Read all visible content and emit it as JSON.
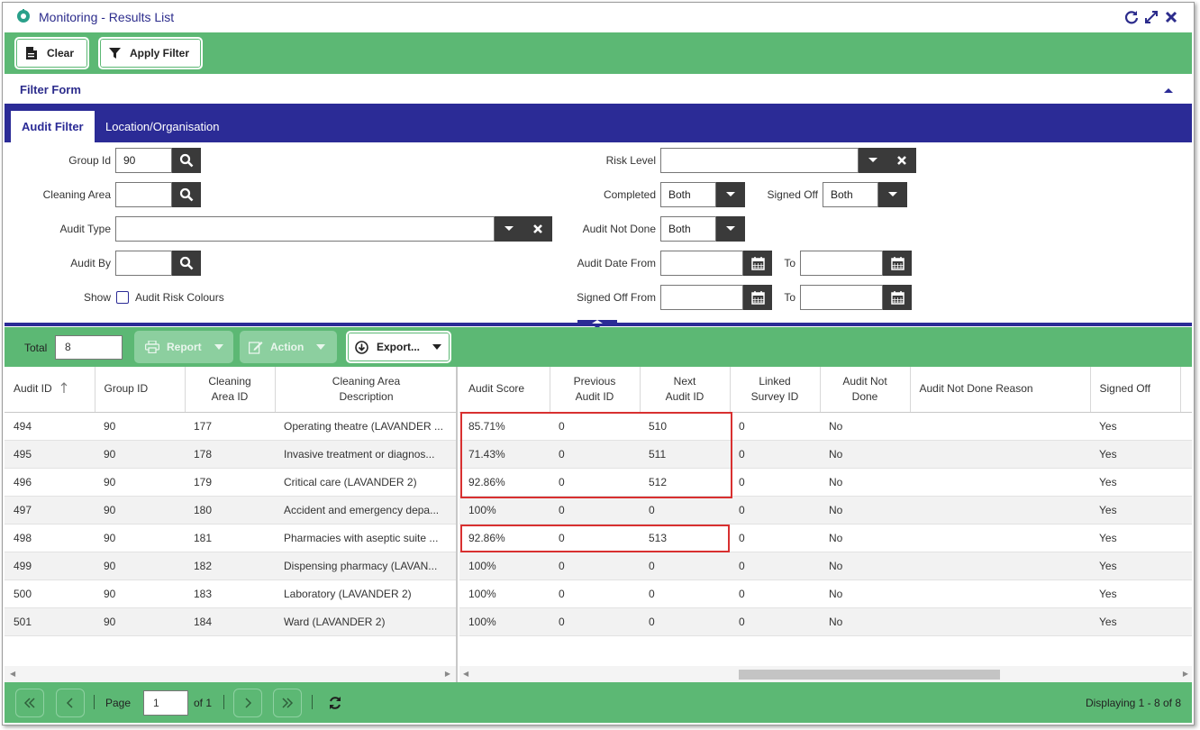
{
  "window": {
    "title": "Monitoring - Results List",
    "controls": [
      "refresh-icon",
      "expand-icon",
      "close-icon"
    ]
  },
  "toolbar": {
    "clear_label": "Clear",
    "apply_filter_label": "Apply Filter"
  },
  "filter_form": {
    "title": "Filter Form",
    "tabs": [
      "Audit Filter",
      "Location/Organisation"
    ],
    "active_tab": "Audit Filter",
    "group_id": {
      "label": "Group Id",
      "value": "90"
    },
    "cleaning_area": {
      "label": "Cleaning Area",
      "value": ""
    },
    "audit_type": {
      "label": "Audit Type",
      "value": ""
    },
    "audit_by": {
      "label": "Audit By",
      "value": ""
    },
    "show": {
      "label": "Show",
      "checkbox_label": "Audit Risk Colours",
      "checked": false
    },
    "risk_level": {
      "label": "Risk Level",
      "value": ""
    },
    "completed": {
      "label": "Completed",
      "value": "Both"
    },
    "signed_off": {
      "label": "Signed Off",
      "value": "Both"
    },
    "audit_not_done": {
      "label": "Audit Not Done",
      "value": "Both"
    },
    "audit_date_from": {
      "label": "Audit Date From",
      "value": "",
      "to_label": "To",
      "to_value": ""
    },
    "signed_off_from": {
      "label": "Signed Off From",
      "value": "",
      "to_label": "To",
      "to_value": ""
    }
  },
  "grid_toolbar": {
    "total_label": "Total",
    "total_value": "8",
    "report_label": "Report",
    "action_label": "Action",
    "export_label": "Export..."
  },
  "grid": {
    "left_columns": [
      "Audit ID",
      "Group ID",
      "Cleaning Area ID",
      "Cleaning Area Description"
    ],
    "right_columns": [
      "Audit Score",
      "Previous Audit ID",
      "Next Audit ID",
      "Linked Survey ID",
      "Audit Not Done",
      "Audit Not Done Reason",
      "Signed Off"
    ],
    "rows": [
      {
        "audit_id": "494",
        "group_id": "90",
        "area_id": "177",
        "area_desc": "Operating theatre (LAVANDER ...",
        "score": "85.71%",
        "prev_id": "0",
        "next_id": "510",
        "survey_id": "0",
        "not_done": "No",
        "reason": "",
        "signed_off": "Yes"
      },
      {
        "audit_id": "495",
        "group_id": "90",
        "area_id": "178",
        "area_desc": "Invasive treatment or diagnos...",
        "score": "71.43%",
        "prev_id": "0",
        "next_id": "511",
        "survey_id": "0",
        "not_done": "No",
        "reason": "",
        "signed_off": "Yes"
      },
      {
        "audit_id": "496",
        "group_id": "90",
        "area_id": "179",
        "area_desc": "Critical care (LAVANDER 2)",
        "score": "92.86%",
        "prev_id": "0",
        "next_id": "512",
        "survey_id": "0",
        "not_done": "No",
        "reason": "",
        "signed_off": "Yes"
      },
      {
        "audit_id": "497",
        "group_id": "90",
        "area_id": "180",
        "area_desc": "Accident and emergency depa...",
        "score": "100%",
        "prev_id": "0",
        "next_id": "0",
        "survey_id": "0",
        "not_done": "No",
        "reason": "",
        "signed_off": "Yes"
      },
      {
        "audit_id": "498",
        "group_id": "90",
        "area_id": "181",
        "area_desc": "Pharmacies with aseptic suite ...",
        "score": "92.86%",
        "prev_id": "0",
        "next_id": "513",
        "survey_id": "0",
        "not_done": "No",
        "reason": "",
        "signed_off": "Yes"
      },
      {
        "audit_id": "499",
        "group_id": "90",
        "area_id": "182",
        "area_desc": "Dispensing pharmacy (LAVAN...",
        "score": "100%",
        "prev_id": "0",
        "next_id": "0",
        "survey_id": "0",
        "not_done": "No",
        "reason": "",
        "signed_off": "Yes"
      },
      {
        "audit_id": "500",
        "group_id": "90",
        "area_id": "183",
        "area_desc": "Laboratory (LAVANDER 2)",
        "score": "100%",
        "prev_id": "0",
        "next_id": "0",
        "survey_id": "0",
        "not_done": "No",
        "reason": "",
        "signed_off": "Yes"
      },
      {
        "audit_id": "501",
        "group_id": "90",
        "area_id": "184",
        "area_desc": "Ward (LAVANDER 2)",
        "score": "100%",
        "prev_id": "0",
        "next_id": "0",
        "survey_id": "0",
        "not_done": "No",
        "reason": "",
        "signed_off": "Yes"
      }
    ],
    "sort_column": "Audit ID",
    "sort_direction": "ascending"
  },
  "pager": {
    "page_label": "Page",
    "page_value": "1",
    "of_label": "of 1",
    "displaying": "Displaying 1 - 8 of 8"
  },
  "colors": {
    "green": "#5cb874",
    "navy": "#2b2b96",
    "highlight": "#d83030"
  }
}
